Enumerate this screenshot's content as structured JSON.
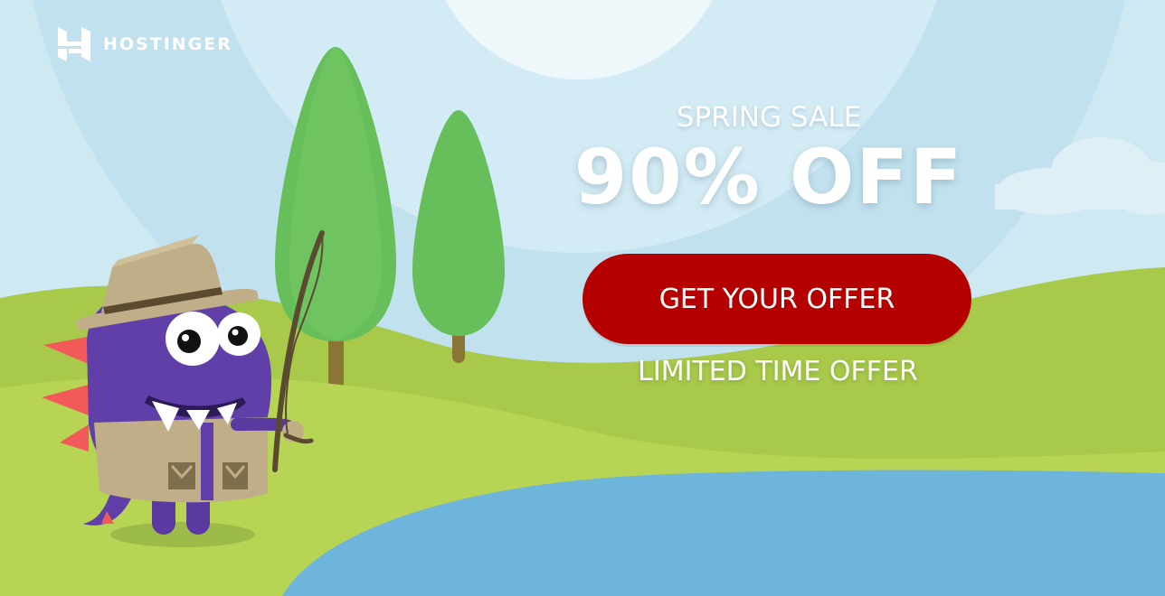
{
  "brand": {
    "name": "HOSTINGER",
    "logo_icon": "hostinger-h-logo-icon"
  },
  "promo": {
    "kicker": "SPRING SALE",
    "headline": "90% OFF",
    "cta_label": "GET YOUR OFFER",
    "note": "LIMITED TIME OFFER"
  },
  "illustration": {
    "mascot": "purple-dino-mascot-fishing",
    "elements": [
      "sky-background",
      "cloud",
      "trees",
      "green-hills",
      "lake",
      "fishing-rod"
    ]
  },
  "colors": {
    "sky": "#cfe9f3",
    "hill": "#a7cc4b",
    "lake": "#6db5db",
    "cta": "#b50000",
    "mascot": "#6040a8",
    "text": "#ffffff"
  }
}
